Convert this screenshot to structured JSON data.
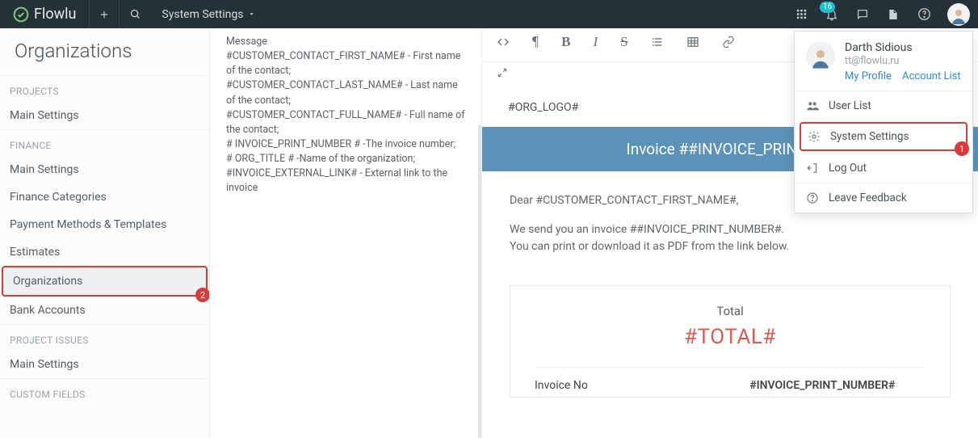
{
  "brand": "Flowlu",
  "breadcrumb": "System Settings",
  "notification_count": "16",
  "page_title": "Organizations",
  "sidebar": {
    "sections": [
      {
        "header": "PROJECTS",
        "items": [
          "Main Settings"
        ]
      },
      {
        "header": "FINANCE",
        "items": [
          "Main Settings",
          "Finance Categories",
          "Payment Methods & Templates",
          "Estimates",
          "Organizations",
          "Bank Accounts"
        ]
      },
      {
        "header": "PROJECT ISSUES",
        "items": [
          "Main Settings"
        ]
      },
      {
        "header": "CUSTOM FIELDS",
        "items": []
      }
    ],
    "active": "Organizations",
    "highlight_badge": "2"
  },
  "variables_desc": {
    "line0": "Message",
    "line1": "#CUSTOMER_CONTACT_FIRST_NAME# - First name of the contact;",
    "line2": "#CUSTOMER_CONTACT_LAST_NAME# - Last name of the contact;",
    "line3": "#CUSTOMER_CONTACT_FULL_NAME# - Full name of the contact;",
    "line4": "# INVOICE_PRINT_NUMBER # -The invoice number;",
    "line5": "# ORG_TITLE # -Name of the organization;",
    "line6": "#INVOICE_EXTERNAL_LINK# - External link to the invoice"
  },
  "email_preview": {
    "org_logo": "#ORG_LOGO#",
    "banner": "Invoice ##INVOICE_PRINT_NU",
    "greeting": "Dear #CUSTOMER_CONTACT_FIRST_NAME#,",
    "body1": "We send you an invoice ##INVOICE_PRINT_NUMBER#.",
    "body2": "You can print or download it as PDF from the link below.",
    "total_label": "Total",
    "total_value": "#TOTAL#",
    "row1_label": "Invoice No",
    "row1_value": "#INVOICE_PRINT_NUMBER#"
  },
  "user_menu": {
    "name": "Darth Sidious",
    "email": "tt@flowlu.ru",
    "my_profile": "My Profile",
    "account_list": "Account List",
    "items": {
      "user_list": "User List",
      "system_settings": "System Settings",
      "log_out": "Log Out",
      "feedback": "Leave Feedback"
    },
    "highlight_badge": "1"
  }
}
